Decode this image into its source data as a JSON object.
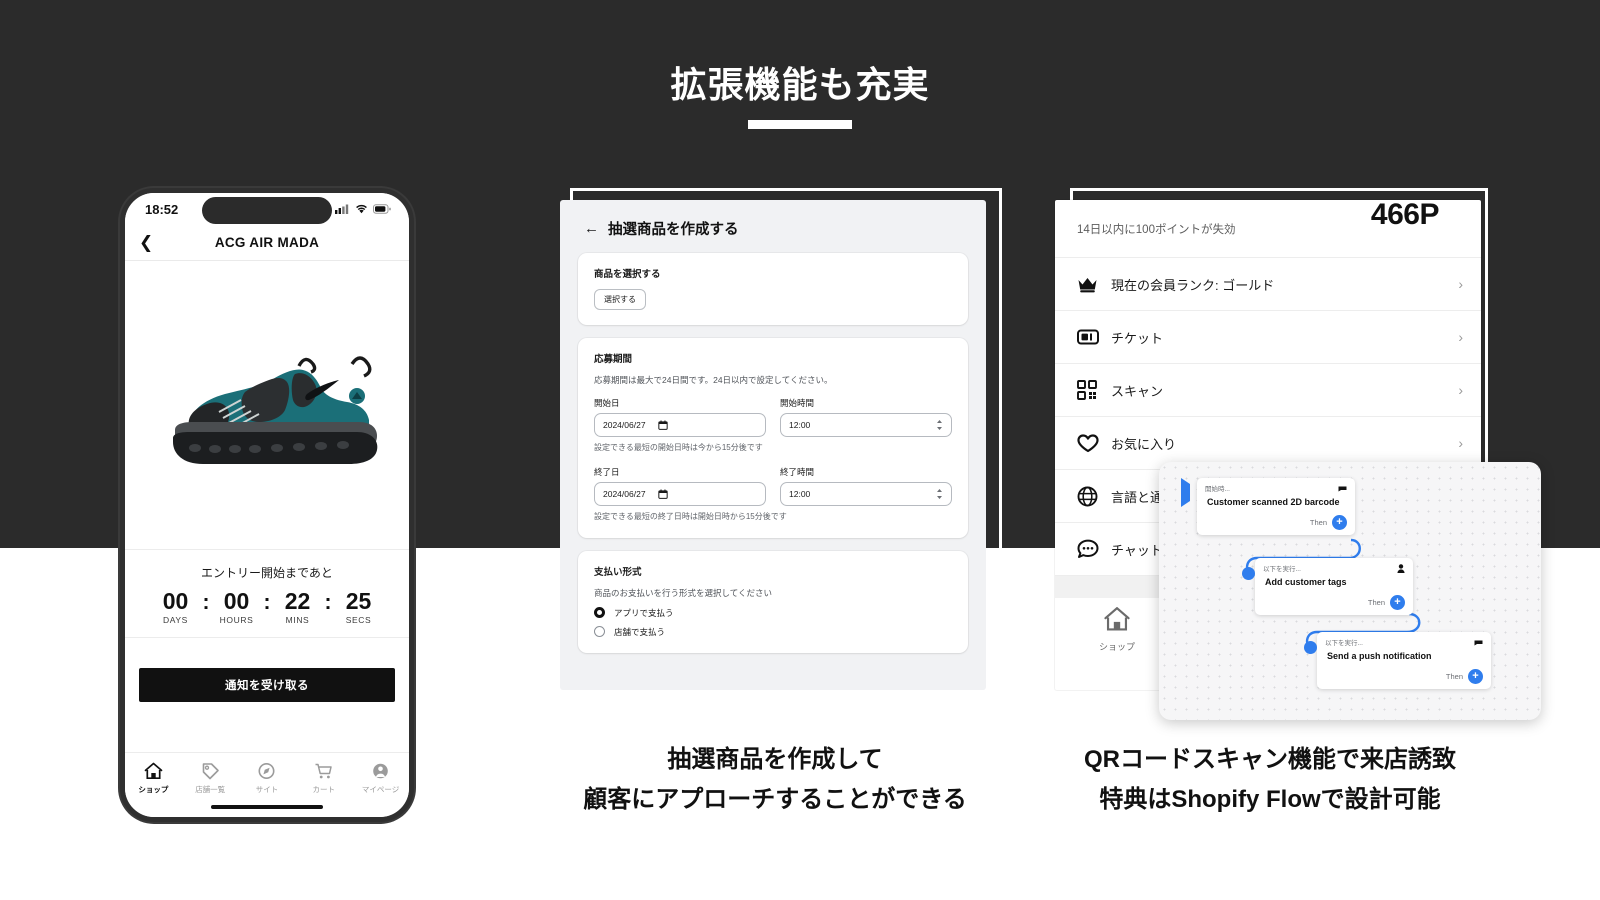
{
  "heading": {
    "title": "拡張機能も充実"
  },
  "phone": {
    "status": {
      "time": "18:52",
      "signal_icon": "cellular-signal-icon",
      "wifi_icon": "wifi-icon",
      "battery_icon": "battery-icon"
    },
    "nav": {
      "back_icon": "chevron-left-icon",
      "title": "ACG AIR MADA"
    },
    "product": {
      "image_alt": "nike-acg-air-mada-shoe",
      "primary_color": "#1b6f78",
      "secondary_color": "#2b2b2b"
    },
    "countdown": {
      "label": "エントリー開始まであと",
      "separator": ":",
      "units": [
        {
          "value": "00",
          "caption": "DAYS"
        },
        {
          "value": "00",
          "caption": "HOURS"
        },
        {
          "value": "22",
          "caption": "MINS"
        },
        {
          "value": "25",
          "caption": "SECS"
        }
      ]
    },
    "cta": {
      "label": "通知を受け取る"
    },
    "tabs": [
      {
        "label": "ショップ",
        "icon": "home-icon",
        "active": true
      },
      {
        "label": "店舗一覧",
        "icon": "tag-icon",
        "active": false
      },
      {
        "label": "サイト",
        "icon": "compass-icon",
        "active": false
      },
      {
        "label": "カート",
        "icon": "cart-icon",
        "active": false
      },
      {
        "label": "マイページ",
        "icon": "person-circle-icon",
        "active": false
      }
    ]
  },
  "admin": {
    "back_icon": "arrow-left-icon",
    "title": "抽選商品を作成する",
    "product_card": {
      "title": "商品を選択する",
      "button": "選択する"
    },
    "period_card": {
      "title": "応募期間",
      "subtitle": "応募期間は最大で24日間です。24日以内で設定してください。",
      "start_date_label": "開始日",
      "start_date_value": "2024/06/27",
      "start_time_label": "開始時間",
      "start_time_value": "12:00",
      "start_hint": "設定できる最短の開始日時は今から15分後です",
      "end_date_label": "終了日",
      "end_date_value": "2024/06/27",
      "end_time_label": "終了時間",
      "end_time_value": "12:00",
      "end_hint": "設定できる最短の終了日時は開始日時から15分後です",
      "calendar_icon": "calendar-icon",
      "stepper_icon": "stepper-updown-icon"
    },
    "payment_card": {
      "title": "支払い形式",
      "subtitle": "商品のお支払いを行う形式を選択してください",
      "options": [
        {
          "label": "アプリで支払う",
          "selected": true
        },
        {
          "label": "店舗で支払う",
          "selected": false
        }
      ]
    }
  },
  "member": {
    "points_expire": "14日以内に100ポイントが失効",
    "points_balance": "466P",
    "items": [
      {
        "label": "現在の会員ランク: ゴールド",
        "icon": "crown-icon"
      },
      {
        "label": "チケット",
        "icon": "ticket-icon"
      },
      {
        "label": "スキャン",
        "icon": "qr-scan-icon"
      },
      {
        "label": "お気に入り",
        "icon": "heart-icon"
      },
      {
        "label": "言語と通貨",
        "icon": "globe-icon"
      },
      {
        "label": "チャット",
        "icon": "chat-bubble-icon"
      }
    ],
    "chevron_icon": "chevron-right-icon",
    "tab": {
      "label": "ショップ",
      "icon": "home-icon"
    }
  },
  "flow": {
    "accent_color": "#2f7ded",
    "nodes": [
      {
        "head": "開始時...",
        "title": "Customer scanned 2D barcode",
        "then": "Then",
        "head_icon": "trigger-flag-icon",
        "marker": "play-triangle"
      },
      {
        "head": "以下を実行...",
        "title": "Add customer tags",
        "then": "Then",
        "head_icon": "person-icon",
        "marker": "dot"
      },
      {
        "head": "以下を実行...",
        "title": "Send a push notification",
        "then": "Then",
        "head_icon": "trigger-flag-icon",
        "marker": "dot"
      }
    ],
    "plus_label": "+"
  },
  "captions": {
    "panel2_line1": "抽選商品を作成して",
    "panel2_line2": "顧客にアプローチすることができる",
    "panel3_line1": "QRコードスキャン機能で来店誘致",
    "panel3_line2": "特典はShopify Flowで設計可能"
  }
}
